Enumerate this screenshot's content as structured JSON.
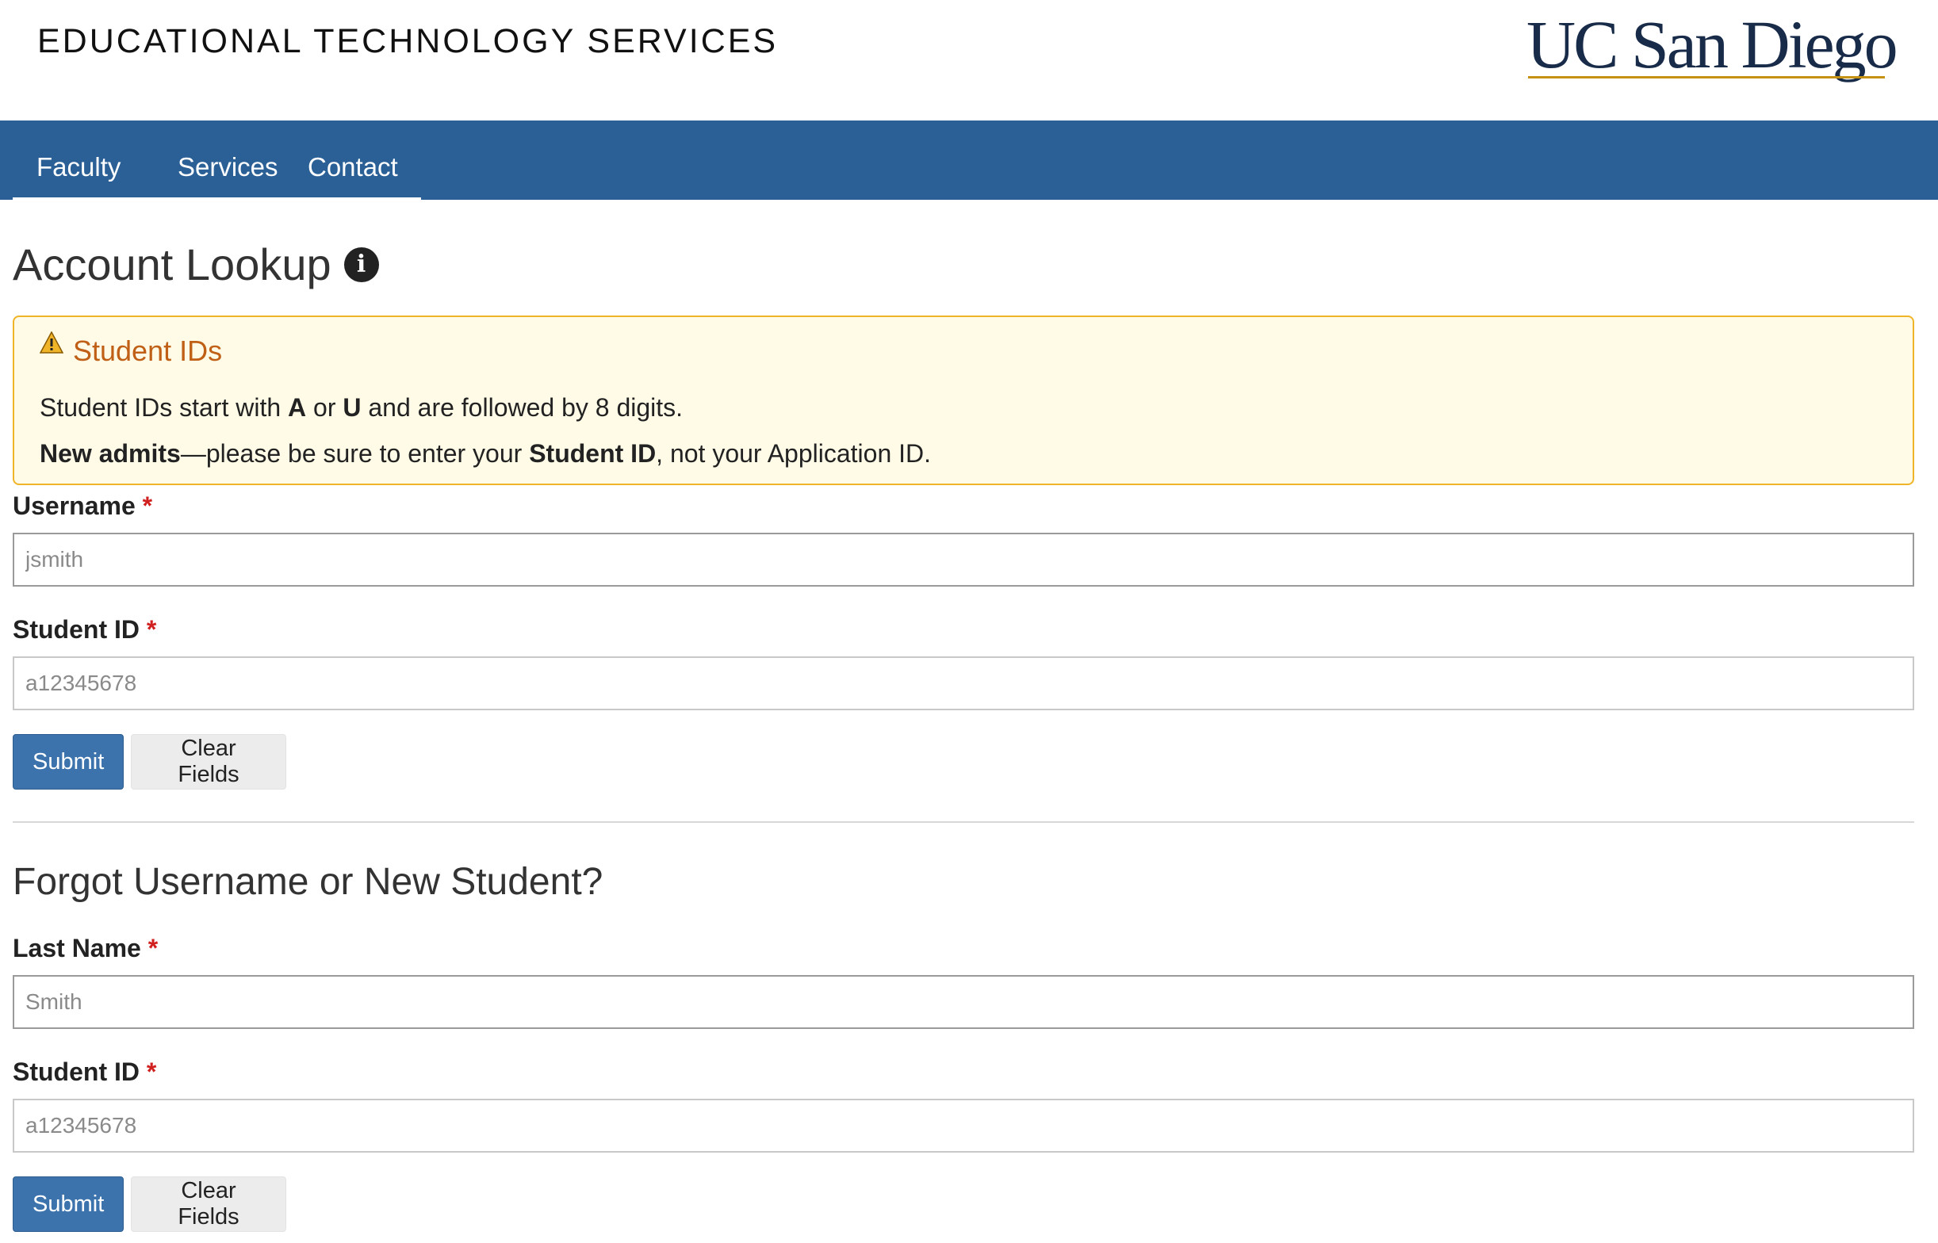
{
  "header": {
    "site_title": "EDUCATIONAL TECHNOLOGY SERVICES",
    "logo_text": "UC San Diego",
    "brand_color": "#182b49",
    "accent_color": "#c69214"
  },
  "nav": {
    "color": "#2b6096",
    "items": [
      {
        "label": "Faculty"
      },
      {
        "label": "Services"
      },
      {
        "label": "Contact"
      }
    ]
  },
  "lookup": {
    "title": "Account Lookup",
    "info_icon": "info-circle-icon",
    "alert": {
      "icon": "warning-icon",
      "heading": "Student IDs",
      "line1": {
        "t1": "Student IDs start with ",
        "b1": "A",
        "t2": " or ",
        "b2": "U",
        "t3": " and are followed by 8 digits."
      },
      "line2": {
        "b1": "New admits",
        "t1": "—please be sure to enter your ",
        "b2": "Student ID",
        "t2": ", not your Application ID."
      }
    },
    "username_label": "Username",
    "username_placeholder": "jsmith",
    "studentid_label": "Student ID",
    "studentid_placeholder": "a12345678",
    "submit_label": "Submit",
    "clear_label": "Clear Fields",
    "required_mark": "*"
  },
  "forgot": {
    "title": "Forgot Username or New Student?",
    "lastname_label": "Last Name",
    "lastname_placeholder": "Smith",
    "studentid_label": "Student ID",
    "studentid_placeholder": "a12345678",
    "submit_label": "Submit",
    "clear_label": "Clear Fields",
    "required_mark": "*"
  }
}
